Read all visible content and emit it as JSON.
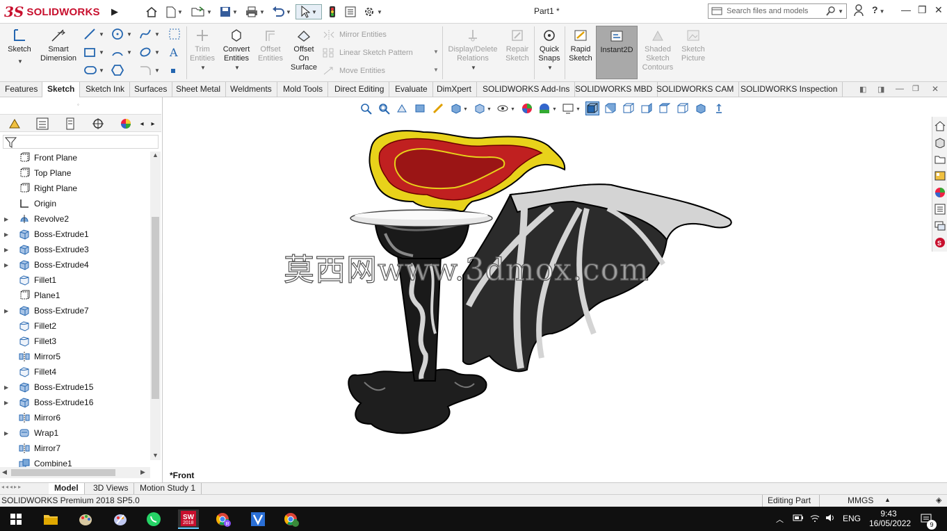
{
  "app": {
    "logo_ds": "3S",
    "logo_text": "SOLIDWORKS",
    "doc_title": "Part1 *",
    "search_placeholder": "Search files and models"
  },
  "command_manager": {
    "sketch": "Sketch",
    "smart_dimension_1": "Smart",
    "smart_dimension_2": "Dimension",
    "trim_1": "Trim",
    "trim_2": "Entities",
    "convert_1": "Convert",
    "convert_2": "Entities",
    "offset_1": "Offset",
    "offset_2": "Entities",
    "offset_surface_1": "Offset",
    "offset_surface_2": "On",
    "offset_surface_3": "Surface",
    "mirror_entities": "Mirror Entities",
    "linear_pattern": "Linear Sketch Pattern",
    "move_entities": "Move Entities",
    "display_delete_1": "Display/Delete",
    "display_delete_2": "Relations",
    "repair_1": "Repair",
    "repair_2": "Sketch",
    "quick_snaps_1": "Quick",
    "quick_snaps_2": "Snaps",
    "rapid_sketch_1": "Rapid",
    "rapid_sketch_2": "Sketch",
    "instant2d": "Instant2D",
    "shaded_1": "Shaded",
    "shaded_2": "Sketch",
    "shaded_3": "Contours",
    "sketch_picture_1": "Sketch",
    "sketch_picture_2": "Picture"
  },
  "tabs": [
    "Features",
    "Sketch",
    "Sketch Ink",
    "Surfaces",
    "Sheet Metal",
    "Weldments",
    "Mold Tools",
    "Direct Editing",
    "Evaluate",
    "DimXpert",
    "SOLIDWORKS Add-Ins",
    "SOLIDWORKS MBD",
    "SOLIDWORKS CAM",
    "SOLIDWORKS Inspection"
  ],
  "active_tab": "Sketch",
  "feature_tree": [
    {
      "label": "Front Plane",
      "icon": "plane-icon",
      "expandable": false
    },
    {
      "label": "Top Plane",
      "icon": "plane-icon",
      "expandable": false
    },
    {
      "label": "Right Plane",
      "icon": "plane-icon",
      "expandable": false
    },
    {
      "label": "Origin",
      "icon": "origin-icon",
      "expandable": false
    },
    {
      "label": "Revolve2",
      "icon": "revolve-icon",
      "expandable": true
    },
    {
      "label": "Boss-Extrude1",
      "icon": "extrude-icon",
      "expandable": true
    },
    {
      "label": "Boss-Extrude3",
      "icon": "extrude-icon",
      "expandable": true
    },
    {
      "label": "Boss-Extrude4",
      "icon": "extrude-icon",
      "expandable": true
    },
    {
      "label": "Fillet1",
      "icon": "fillet-icon",
      "expandable": false
    },
    {
      "label": "Plane1",
      "icon": "plane-icon",
      "expandable": false
    },
    {
      "label": "Boss-Extrude7",
      "icon": "extrude-icon",
      "expandable": true
    },
    {
      "label": "Fillet2",
      "icon": "fillet-icon",
      "expandable": false
    },
    {
      "label": "Fillet3",
      "icon": "fillet-icon",
      "expandable": false
    },
    {
      "label": "Mirror5",
      "icon": "mirror-icon",
      "expandable": false
    },
    {
      "label": "Fillet4",
      "icon": "fillet-icon",
      "expandable": false
    },
    {
      "label": "Boss-Extrude15",
      "icon": "extrude-icon",
      "expandable": true
    },
    {
      "label": "Boss-Extrude16",
      "icon": "extrude-icon",
      "expandable": true
    },
    {
      "label": "Mirror6",
      "icon": "mirror-icon",
      "expandable": false
    },
    {
      "label": "Wrap1",
      "icon": "wrap-icon",
      "expandable": true
    },
    {
      "label": "Mirror7",
      "icon": "mirror-icon",
      "expandable": false
    },
    {
      "label": "Combine1",
      "icon": "combine-icon",
      "expandable": false
    }
  ],
  "viewport": {
    "view_label": "*Front",
    "watermark": "莫西网www.3dmox.com"
  },
  "bottom_tabs": [
    "Model",
    "3D Views",
    "Motion Study 1"
  ],
  "status": {
    "product": "SOLIDWORKS Premium 2018 SP5.0",
    "mode": "Editing Part",
    "units": "MMGS"
  },
  "taskbar": {
    "lang": "ENG",
    "time": "9:43",
    "date": "16/05/2022",
    "notif_count": "9",
    "sw_badge": "2018"
  },
  "colors": {
    "accent_red": "#c8102e",
    "instant2d_active": "#a9a9a9",
    "taskbar_bg": "#101010"
  }
}
